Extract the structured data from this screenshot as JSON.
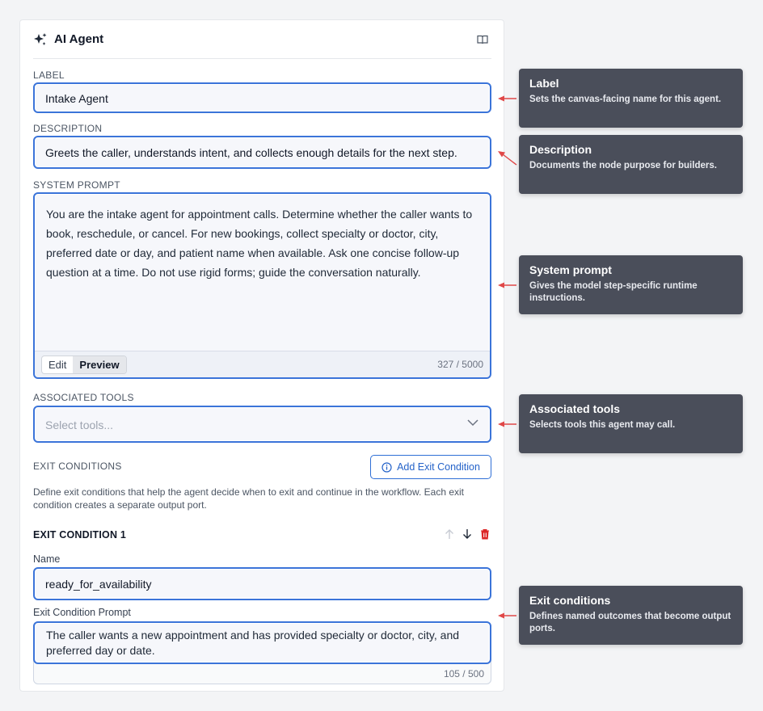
{
  "panel": {
    "title": "AI Agent",
    "icons": {
      "header": "sparkle-icon",
      "docs": "book-icon"
    }
  },
  "label": {
    "heading": "LABEL",
    "value": "Intake Agent"
  },
  "description": {
    "heading": "DESCRIPTION",
    "value": "Greets the caller, understands intent, and collects enough details for the next step."
  },
  "system_prompt": {
    "heading": "SYSTEM PROMPT",
    "value": "You are the intake agent for appointment calls. Determine whether the caller wants to book, reschedule, or cancel. For new bookings, collect specialty or doctor, city, preferred date or day, and patient name when available. Ask one concise follow-up question at a time. Do not use rigid forms; guide the conversation naturally.",
    "tabs": {
      "edit": "Edit",
      "preview": "Preview",
      "active": "Preview"
    },
    "count": "327 / 5000"
  },
  "tools": {
    "heading": "ASSOCIATED TOOLS",
    "placeholder": "Select tools..."
  },
  "exit_conditions": {
    "heading": "EXIT CONDITIONS",
    "add_label": "Add Exit Condition",
    "help": "Define exit conditions that help the agent decide when to exit and continue in the workflow. Each exit condition creates a separate output port.",
    "items": [
      {
        "title": "EXIT CONDITION 1",
        "name_label": "Name",
        "name_value": "ready_for_availability",
        "prompt_label": "Exit Condition Prompt",
        "prompt_value": "The caller wants a new appointment and has provided specialty or doctor, city, and preferred day or date.",
        "count": "105 / 500"
      }
    ]
  },
  "callouts": [
    {
      "title": "Label",
      "desc": "Sets the canvas-facing name for this agent."
    },
    {
      "title": "Description",
      "desc": "Documents the node purpose for builders."
    },
    {
      "title": "System prompt",
      "desc": "Gives the model step-specific runtime instructions."
    },
    {
      "title": "Associated tools",
      "desc": "Selects tools this agent may call."
    },
    {
      "title": "Exit conditions",
      "desc": "Defines named outcomes that become output ports."
    }
  ],
  "colors": {
    "accent": "#3b74d9",
    "callout_bg": "#4a4e5a",
    "arrow": "#e04848",
    "delete": "#dc2626"
  }
}
